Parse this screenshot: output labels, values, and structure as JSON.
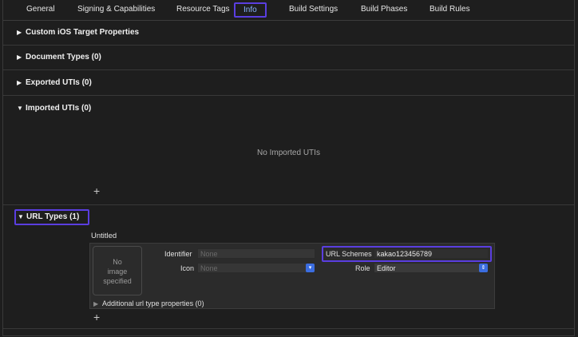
{
  "tabs": [
    {
      "label": "General"
    },
    {
      "label": "Signing & Capabilities"
    },
    {
      "label": "Resource Tags"
    },
    {
      "label": "Info",
      "selected": true
    },
    {
      "label": "Build Settings"
    },
    {
      "label": "Build Phases"
    },
    {
      "label": "Build Rules"
    }
  ],
  "sections": {
    "custom_ios": "Custom iOS Target Properties",
    "document_types": "Document Types (0)",
    "exported_utis": "Exported UTIs (0)",
    "imported_utis": "Imported UTIs (0)",
    "imported_empty": "No Imported UTIs",
    "url_types": "URL Types (1)"
  },
  "url_type": {
    "name": "Untitled",
    "image_placeholder_line1": "No",
    "image_placeholder_line2": "image",
    "image_placeholder_line3": "specified",
    "identifier_label": "Identifier",
    "identifier_placeholder": "None",
    "icon_label": "Icon",
    "icon_placeholder": "None",
    "url_schemes_label": "URL Schemes",
    "url_schemes_value": "kakao123456789",
    "role_label": "Role",
    "role_value": "Editor",
    "additional": "Additional url type properties (0)"
  },
  "icons": {
    "plus": "+",
    "triangle_right": "▶",
    "triangle_down": "▼"
  },
  "colors": {
    "highlight": "#5a3ee0",
    "popup_accent": "#3b6de0",
    "background": "#1e1e1e"
  }
}
